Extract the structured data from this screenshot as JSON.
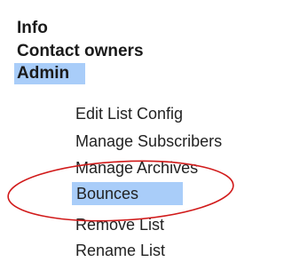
{
  "menu": {
    "items": [
      {
        "label": "Info"
      },
      {
        "label": "Contact owners"
      },
      {
        "label": "Admin"
      }
    ],
    "admin_items": [
      {
        "label": "Edit List Config"
      },
      {
        "label": "Manage Subscribers"
      },
      {
        "label": "Manage Archives"
      },
      {
        "label": "Bounces"
      },
      {
        "label": "Remove List"
      },
      {
        "label": "Rename List"
      }
    ]
  },
  "highlight_color": "#a9cdf9",
  "annotation_color": "#d11a1a"
}
